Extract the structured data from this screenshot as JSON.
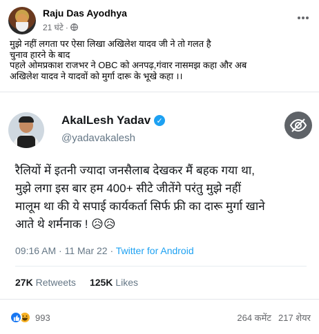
{
  "post": {
    "author": "Raju Das Ayodhya",
    "time": "21 घंटे",
    "time_separator": "·",
    "caption_lines": [
      "मुझे नहीं लगता पर ऐसा लिखा अखिलेश यादव जी ने तो गलत है",
      "चुनाव हारने के बाद",
      "पहले ओमप्रकाश राजभर ने OBC को अनपढ़,गंवार नासमझ कहा और अब",
      "अखिलेश यादव ने यादवों को मुर्गा दारू के भूखे कहा ।।"
    ]
  },
  "tweet": {
    "name": "AkalLesh Yadav",
    "handle": "@yadavakalesh",
    "text_lines": [
      "रैलियों में इतनी ज्यादा जनसैलाब देखकर मैं बहक गया था,",
      "मुझे लगा इस बार हम 400+ सीटे जीतेंगे परंतु मुझे नहीं",
      "मालूम था की ये सपाई कार्यकर्ता सिर्फ फ्री का दारू मुर्गा खाने",
      "आते थे शर्मनाक ! 😥😥"
    ],
    "time": "09:16 AM · 11 Mar 22 · ",
    "source": "Twitter for Android",
    "retweets_count": "27K",
    "retweets_label": "Retweets",
    "likes_count": "125K",
    "likes_label": "Likes"
  },
  "footer": {
    "reaction_count": "993",
    "comments": "264 कमेंट",
    "shares": "217 शेयर"
  },
  "icons": [
    "globe-icon",
    "more-icon",
    "verified-icon",
    "eye-icon",
    "like-reaction-icon",
    "haha-reaction-icon"
  ],
  "colors": {
    "twitter_blue": "#1da1f2",
    "fb_blue": "#1877f2",
    "muted": "#65676b"
  }
}
